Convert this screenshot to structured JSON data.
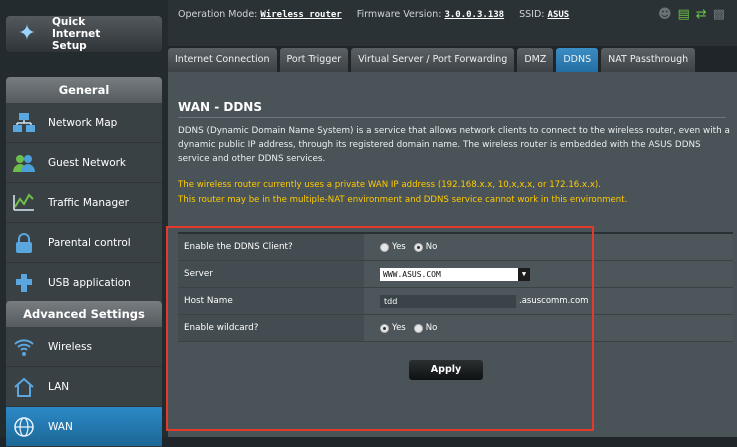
{
  "sidebar": {
    "quick_setup": "Quick Internet Setup",
    "general_heading": "General",
    "general_items": [
      {
        "label": "Network Map",
        "icon": "network-map-icon"
      },
      {
        "label": "Guest Network",
        "icon": "guest-network-icon"
      },
      {
        "label": "Traffic Manager",
        "icon": "traffic-manager-icon"
      },
      {
        "label": "Parental control",
        "icon": "parental-control-icon"
      },
      {
        "label": "USB application",
        "icon": "usb-application-icon"
      }
    ],
    "advanced_heading": "Advanced Settings",
    "advanced_items": [
      {
        "label": "Wireless",
        "icon": "wireless-icon"
      },
      {
        "label": "LAN",
        "icon": "lan-icon"
      },
      {
        "label": "WAN",
        "icon": "wan-icon",
        "active": true
      }
    ]
  },
  "header": {
    "op_mode_label": "Operation Mode:",
    "op_mode_value": "Wireless router",
    "fw_label": "Firmware Version:",
    "fw_value": "3.0.0.3.138",
    "ssid_label": "SSID:",
    "ssid_value": "ASUS"
  },
  "tabs": [
    "Internet Connection",
    "Port Trigger",
    "Virtual Server / Port Forwarding",
    "DMZ",
    "DDNS",
    "NAT Passthrough"
  ],
  "active_tab": "DDNS",
  "page": {
    "title": "WAN - DDNS",
    "description": "DDNS (Dynamic Domain Name System) is a service that allows network clients to connect to the wireless router, even with a dynamic public IP address, through its registered domain name. The wireless router is embedded with the ASUS DDNS service and other DDNS services.",
    "warning_line1": "The wireless router currently uses a private WAN IP address (192.168.x.x, 10,x,x,x, or 172.16.x.x).",
    "warning_line2": "This router may be in the multiple-NAT environment and DDNS service cannot work in this environment."
  },
  "form": {
    "enable_ddns_label": "Enable the DDNS Client?",
    "yes_label": "Yes",
    "no_label": "No",
    "enable_ddns_value": "Yes",
    "server_label": "Server",
    "server_value": "WWW.ASUS.COM",
    "host_label": "Host Name",
    "host_value": "tdd",
    "host_suffix": ".asuscomm.com",
    "wildcard_label": "Enable wildcard?",
    "wildcard_value": "No",
    "apply_label": "Apply"
  },
  "colors": {
    "accent": "#2b89c6",
    "warning": "#ffcc00",
    "highlight": "#e43a2d"
  }
}
